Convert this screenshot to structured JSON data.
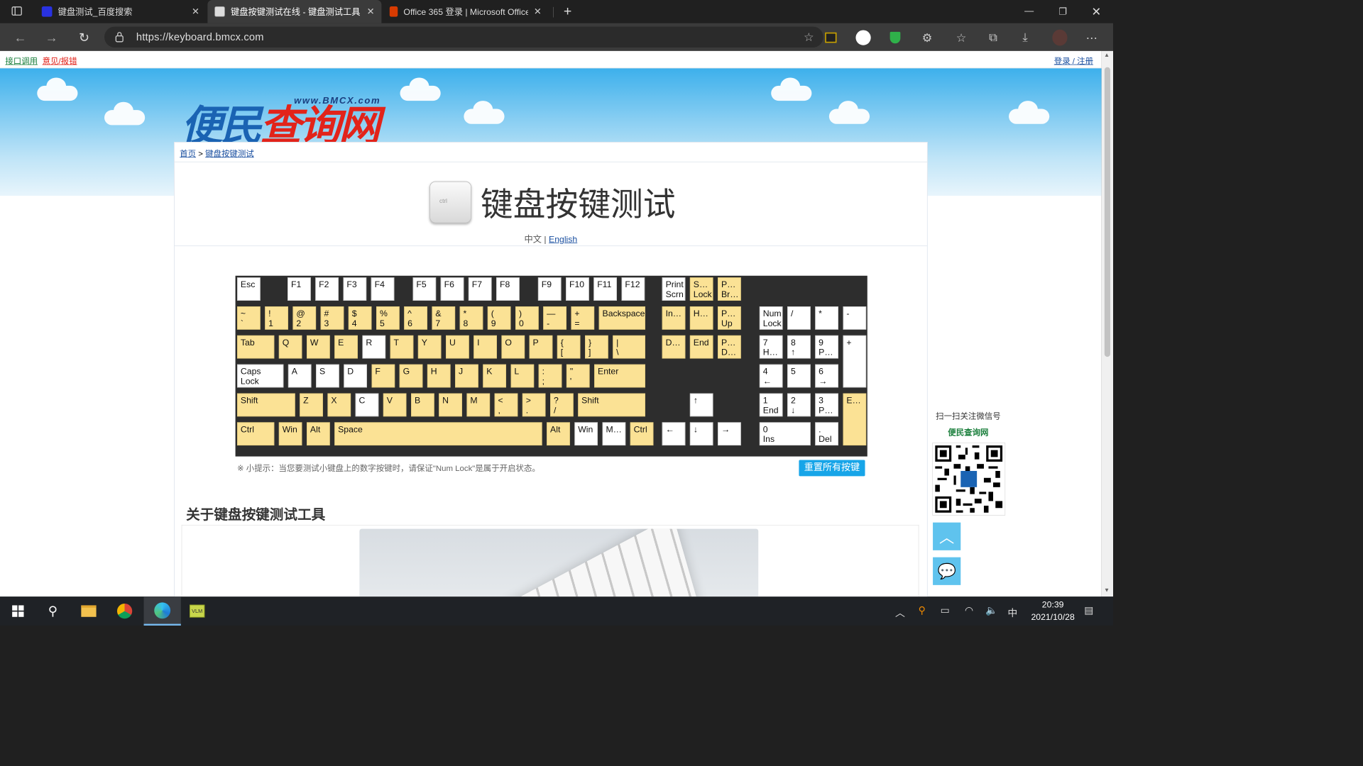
{
  "browser": {
    "tabs": [
      {
        "title": "键盘测试_百度搜索",
        "favicon": "baidu-paw-icon",
        "color": "#2932e1"
      },
      {
        "title": "键盘按键测试在线 - 键盘测试工具",
        "favicon": "page-icon",
        "color": "#bbbbbb"
      },
      {
        "title": "Office 365 登录 | Microsoft Office",
        "favicon": "office-icon",
        "color": "#d83b01"
      }
    ],
    "new_tab": "+",
    "url": "https://keyboard.bmcx.com"
  },
  "page": {
    "topbar": {
      "api": "接口调用",
      "feedback": "意见/报错",
      "login": "登录 / 注册"
    },
    "logo": {
      "brand_part1": "便民",
      "brand_part2": "查询网",
      "url": "www.BMCX.com"
    },
    "breadcrumb": {
      "home": "首页",
      "sep": ">",
      "current": "键盘按键测试"
    },
    "title": "键盘按键测试",
    "key_icon_label": "ctrl",
    "lang": {
      "zh": "中文",
      "sep": "|",
      "en": "English"
    },
    "tip": "※ 小提示：当您要测试小键盘上的数字按键时，请保证\"Num Lock\"是属于开启状态。",
    "reset_button": "重置所有按键",
    "about_heading": "关于键盘按键测试工具",
    "side": {
      "scan": "扫一扫关注微信号",
      "name": "便民查询网"
    }
  },
  "keyboard": {
    "keys": [
      {
        "l": "Esc",
        "y": false
      },
      {
        "l": "F1",
        "y": false
      },
      {
        "l": "F2",
        "y": false
      },
      {
        "l": "F3",
        "y": false
      },
      {
        "l": "F4",
        "y": false
      },
      {
        "l": "F5",
        "y": false
      },
      {
        "l": "F6",
        "y": false
      },
      {
        "l": "F7",
        "y": false
      },
      {
        "l": "F8",
        "y": false
      },
      {
        "l": "F9",
        "y": false
      },
      {
        "l": "F10",
        "y": false
      },
      {
        "l": "F11",
        "y": false
      },
      {
        "l": "F12",
        "y": false
      },
      {
        "l": "Print\nScrn",
        "y": false
      },
      {
        "l": "S…\nLock",
        "y": true
      },
      {
        "l": "P…\nBr…",
        "y": true
      },
      {
        "l": "~\n`",
        "y": true
      },
      {
        "l": "!\n1",
        "y": true
      },
      {
        "l": "@\n2",
        "y": true
      },
      {
        "l": "#\n3",
        "y": true
      },
      {
        "l": "$\n4",
        "y": true
      },
      {
        "l": "%\n5",
        "y": true
      },
      {
        "l": "^\n6",
        "y": true
      },
      {
        "l": "&\n7",
        "y": true
      },
      {
        "l": "*\n8",
        "y": true
      },
      {
        "l": "(\n9",
        "y": true
      },
      {
        "l": ")\n0",
        "y": true
      },
      {
        "l": "—\n-",
        "y": true
      },
      {
        "l": "+\n=",
        "y": true
      },
      {
        "l": "Backspace",
        "y": true
      },
      {
        "l": "In…",
        "y": true
      },
      {
        "l": "H…",
        "y": true
      },
      {
        "l": "P…\nUp",
        "y": true
      },
      {
        "l": "Num\nLock",
        "y": false
      },
      {
        "l": "/",
        "y": false
      },
      {
        "l": "*",
        "y": false
      },
      {
        "l": "-",
        "y": false
      },
      {
        "l": "Tab",
        "y": true
      },
      {
        "l": "Q",
        "y": true
      },
      {
        "l": "W",
        "y": true
      },
      {
        "l": "E",
        "y": true
      },
      {
        "l": "R",
        "y": false
      },
      {
        "l": "T",
        "y": true
      },
      {
        "l": "Y",
        "y": true
      },
      {
        "l": "U",
        "y": true
      },
      {
        "l": "I",
        "y": true
      },
      {
        "l": "O",
        "y": true
      },
      {
        "l": "P",
        "y": true
      },
      {
        "l": "{\n[",
        "y": true
      },
      {
        "l": "}\n]",
        "y": true
      },
      {
        "l": "|\n\\",
        "y": true
      },
      {
        "l": "D…",
        "y": true
      },
      {
        "l": "End",
        "y": true
      },
      {
        "l": "P…\nD…",
        "y": true
      },
      {
        "l": "7\nH…",
        "y": false
      },
      {
        "l": "8\n↑",
        "y": false
      },
      {
        "l": "9\nP…",
        "y": false
      },
      {
        "l": "+",
        "y": false
      },
      {
        "l": "Caps\nLock",
        "y": false
      },
      {
        "l": "A",
        "y": false
      },
      {
        "l": "S",
        "y": false
      },
      {
        "l": "D",
        "y": false
      },
      {
        "l": "F",
        "y": true
      },
      {
        "l": "G",
        "y": true
      },
      {
        "l": "H",
        "y": true
      },
      {
        "l": "J",
        "y": true
      },
      {
        "l": "K",
        "y": true
      },
      {
        "l": "L",
        "y": true
      },
      {
        "l": ":\n;",
        "y": true
      },
      {
        "l": "\"\n'",
        "y": true
      },
      {
        "l": "Enter",
        "y": true
      },
      {
        "l": "4\n←",
        "y": false
      },
      {
        "l": "5",
        "y": false
      },
      {
        "l": "6\n→",
        "y": false
      },
      {
        "l": "Shift",
        "y": true
      },
      {
        "l": "Z",
        "y": true
      },
      {
        "l": "X",
        "y": true
      },
      {
        "l": "C",
        "y": false
      },
      {
        "l": "V",
        "y": true
      },
      {
        "l": "B",
        "y": true
      },
      {
        "l": "N",
        "y": true
      },
      {
        "l": "M",
        "y": true
      },
      {
        "l": "<\n,",
        "y": true
      },
      {
        "l": ">\n.",
        "y": true
      },
      {
        "l": "?\n/",
        "y": true
      },
      {
        "l": "Shift",
        "y": true
      },
      {
        "l": "↑",
        "y": false
      },
      {
        "l": "1\nEnd",
        "y": false
      },
      {
        "l": "2\n↓",
        "y": false
      },
      {
        "l": "3\nP…",
        "y": false
      },
      {
        "l": "E…",
        "y": true
      },
      {
        "l": "Ctrl",
        "y": true
      },
      {
        "l": "Win",
        "y": true
      },
      {
        "l": "Alt",
        "y": true
      },
      {
        "l": "Space",
        "y": true
      },
      {
        "l": "Alt",
        "y": true
      },
      {
        "l": "Win",
        "y": false
      },
      {
        "l": "M…",
        "y": false
      },
      {
        "l": "Ctrl",
        "y": true
      },
      {
        "l": "←",
        "y": false
      },
      {
        "l": "↓",
        "y": false
      },
      {
        "l": "→",
        "y": false
      },
      {
        "l": "0\nIns",
        "y": false
      },
      {
        "l": ".\nDel",
        "y": false
      }
    ],
    "colors": {
      "pressed": "#fbe295",
      "idle": "#ffffff",
      "board": "#2d2d2d"
    }
  },
  "taskbar": {
    "apps": [
      "windows-start-icon",
      "search-icon",
      "file-explorer-icon",
      "chrome-icon",
      "edge-icon",
      "vlm-app-icon"
    ],
    "ime": "中",
    "time": "20:39",
    "date": "2021/10/28"
  }
}
